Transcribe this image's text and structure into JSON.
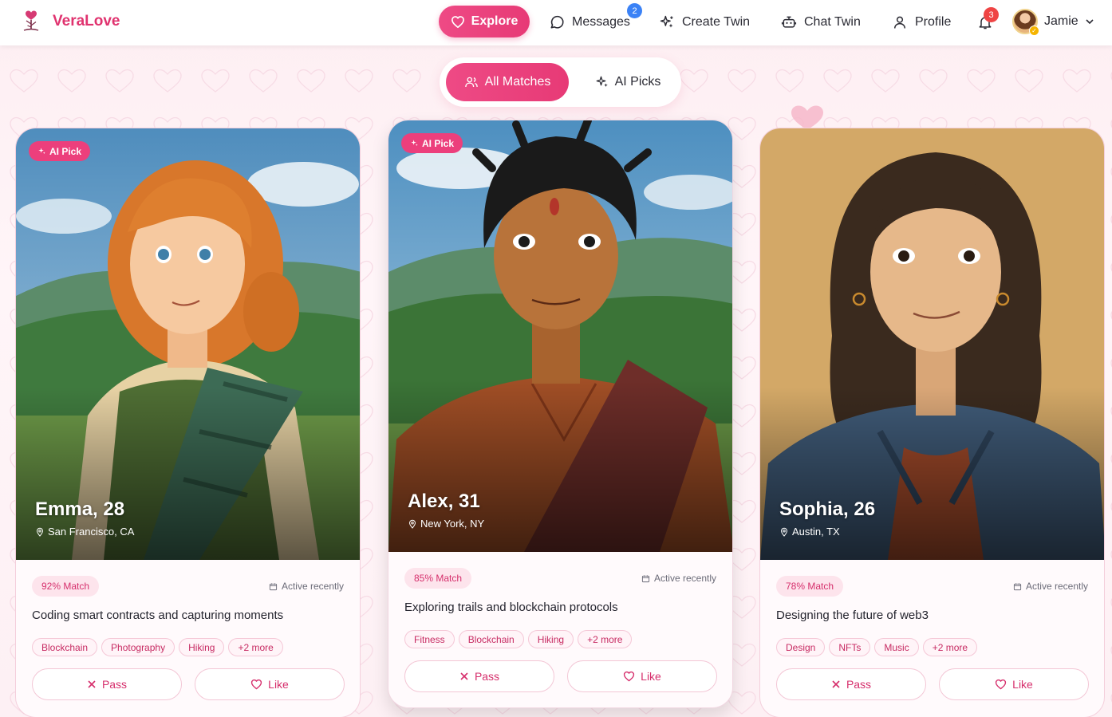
{
  "brand": {
    "name": "VeraLove"
  },
  "nav": {
    "explore": "Explore",
    "messages": "Messages",
    "messages_badge": "2",
    "create_twin": "Create Twin",
    "chat_twin": "Chat Twin",
    "profile": "Profile",
    "notifications_badge": "3",
    "user_name": "Jamie"
  },
  "tabs": {
    "all_matches": "All Matches",
    "ai_picks": "AI Picks"
  },
  "colors": {
    "accent": "#e73a76",
    "badge_blue": "#3b82f6",
    "badge_red": "#ef4444"
  },
  "cards": [
    {
      "ai_pick": "AI Pick",
      "name": "Emma, 28",
      "location": "San Francisco, CA",
      "match": "92% Match",
      "active": "Active recently",
      "bio": "Coding smart contracts and capturing moments",
      "tags": [
        "Blockchain",
        "Photography",
        "Hiking",
        "+2 more"
      ],
      "pass": "Pass",
      "like": "Like"
    },
    {
      "ai_pick": "AI Pick",
      "name": "Alex, 31",
      "location": "New York, NY",
      "match": "85% Match",
      "active": "Active recently",
      "bio": "Exploring trails and blockchain protocols",
      "tags": [
        "Fitness",
        "Blockchain",
        "Hiking",
        "+2 more"
      ],
      "pass": "Pass",
      "like": "Like"
    },
    {
      "name": "Sophia, 26",
      "location": "Austin, TX",
      "match": "78% Match",
      "active": "Active recently",
      "bio": "Designing the future of web3",
      "tags": [
        "Design",
        "NFTs",
        "Music",
        "+2 more"
      ],
      "pass": "Pass",
      "like": "Like"
    }
  ]
}
